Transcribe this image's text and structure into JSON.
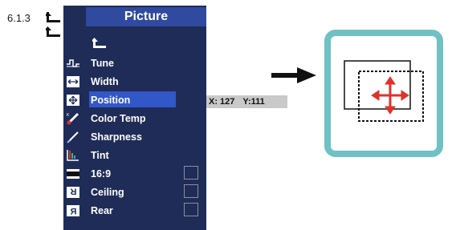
{
  "section": {
    "number": "6.1.3"
  },
  "menu": {
    "title": "Picture",
    "items": [
      {
        "id": "back",
        "label": "",
        "icon": "return-arrow-icon"
      },
      {
        "id": "tune",
        "label": "Tune",
        "icon": "tune-icon"
      },
      {
        "id": "width",
        "label": "Width",
        "icon": "width-icon"
      },
      {
        "id": "position",
        "label": "Position",
        "icon": "position-icon",
        "selected": true
      },
      {
        "id": "color-temp",
        "label": "Color Temp",
        "icon": "color-temp-icon"
      },
      {
        "id": "sharpness",
        "label": "Sharpness",
        "icon": "sharpness-icon"
      },
      {
        "id": "tint",
        "label": "Tint",
        "icon": "tint-icon"
      },
      {
        "id": "aspect",
        "label": "16:9",
        "icon": "aspect-16-9-icon",
        "checkbox": true
      },
      {
        "id": "ceiling",
        "label": "Ceiling",
        "icon": "ceiling-icon",
        "checkbox": true
      },
      {
        "id": "rear",
        "label": "Rear",
        "icon": "rear-icon",
        "checkbox": true
      }
    ]
  },
  "readout": {
    "x_label": "X: 127",
    "y_label": "Y:111"
  },
  "colors": {
    "menu_bg": "#1f2c57",
    "title_bg": "#2f4a9e",
    "selected_bg": "#3257c8",
    "frame_border": "#6fc1c4",
    "cross_arrows": "#e0322a"
  }
}
